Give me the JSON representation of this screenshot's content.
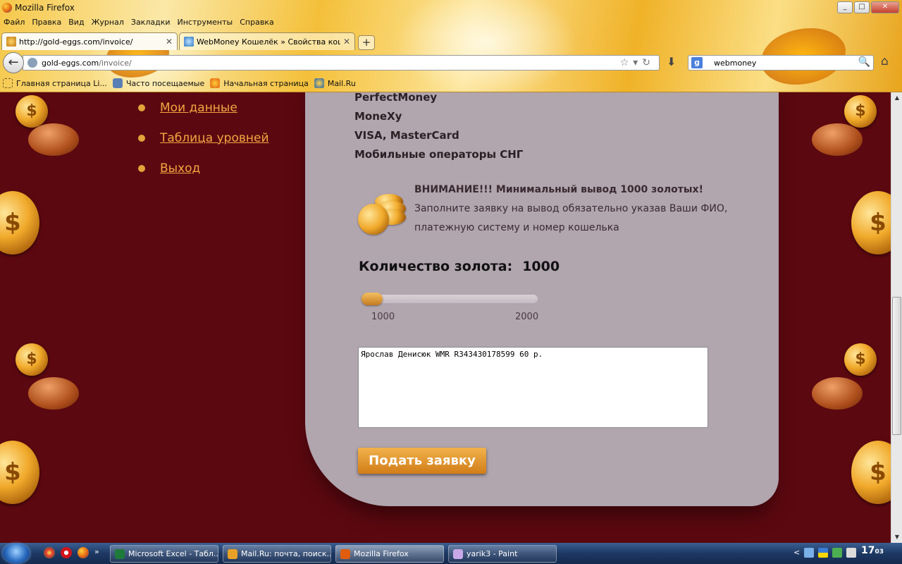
{
  "window": {
    "title": "Mozilla Firefox",
    "controls": [
      "_",
      "□",
      "✕"
    ]
  },
  "menubar": [
    "Файл",
    "Правка",
    "Вид",
    "Журнал",
    "Закладки",
    "Инструменты",
    "Справка"
  ],
  "tabs": [
    {
      "label": "http://gold-eggs.com/invoice/",
      "close": "✕"
    },
    {
      "label": "WebMoney Кошелёк » Свойства кошел...",
      "close": "✕"
    }
  ],
  "new_tab": "+",
  "nav": {
    "back": "←",
    "url_domain": "gold-eggs.com",
    "url_path": "/invoice/",
    "url_icons": "☆▾↻",
    "download": "⬇",
    "search_engine": "g",
    "search_value": "webmoney",
    "search_icon": "🔍",
    "home": "⌂"
  },
  "bookmarks": [
    "Главная страница Li...",
    "Часто посещаемые",
    "Начальная страница",
    "Mail.Ru"
  ],
  "sidebar_menu": [
    "Мои данные",
    "Таблица уровней",
    "Выход"
  ],
  "payment_list": [
    "PerfectMoney",
    "MoneXy",
    "VISA, MasterCard",
    "Мобильные операторы СНГ"
  ],
  "notice": {
    "bold": "ВНИМАНИЕ!!! Минимальный вывод 1000 золотых!",
    "text": " Заполните заявку на вывод обязательно указав Ваши ФИО, платежную систему и номер кошелька"
  },
  "quantity": {
    "label": "Количество золота:",
    "value": "1000"
  },
  "slider": {
    "min": "1000",
    "max": "2000",
    "value_fraction": 0
  },
  "request_text": "Ярослав Денисюк WMR R343430178599 60 р.",
  "submit_label": "Подать заявку",
  "taskbar": {
    "windows": [
      {
        "label": "Microsoft Excel - Табл...",
        "color": "#1e7a3a"
      },
      {
        "label": "Mail.Ru: почта, поиск...",
        "color": "#e8a126"
      },
      {
        "label": "Mozilla Firefox",
        "color": "#e05d0f"
      },
      {
        "label": "yarik3 - Paint",
        "color": "#c9a8e8"
      }
    ],
    "quicklaunch_more": "»",
    "tray_arrow": "<",
    "clock_hour": "17",
    "clock_min": "03"
  },
  "colors": {
    "page_bg": "#5c0810",
    "panel_bg": "#b1a5ae",
    "accent": "#f2a742"
  }
}
